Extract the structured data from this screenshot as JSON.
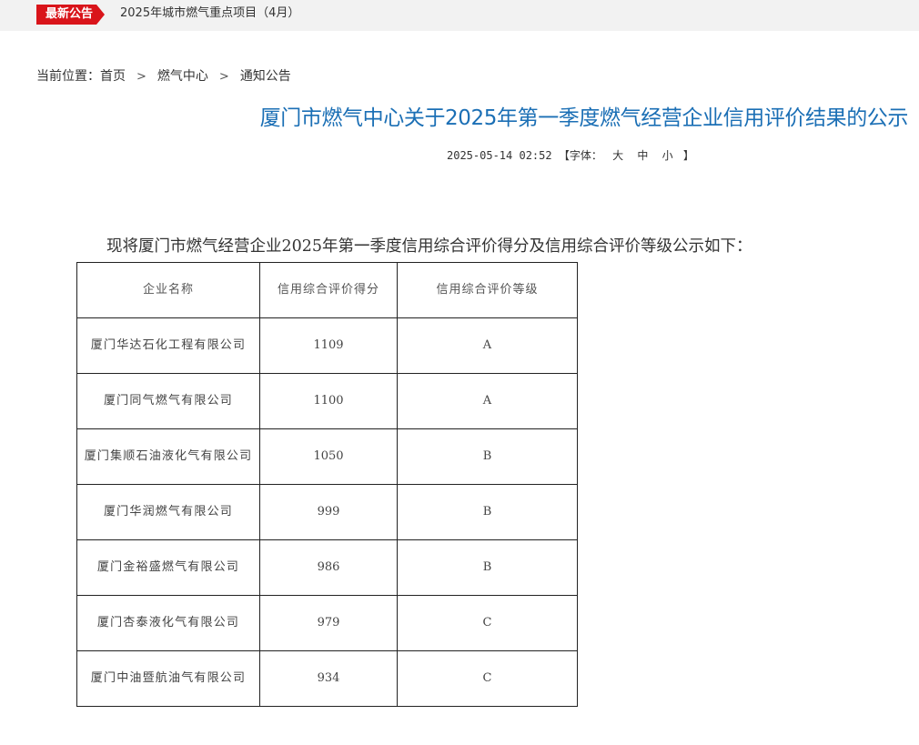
{
  "ticker": {
    "badge": "最新公告",
    "headline": "2025年城市燃气重点项目（4月）"
  },
  "breadcrumb": {
    "label": "当前位置：",
    "items": [
      "首页",
      "燃气中心",
      "通知公告"
    ]
  },
  "article": {
    "title": "厦门市燃气中心关于2025年第一季度燃气经营企业信用评价结果的公示",
    "datetime": "2025-05-14 02:52",
    "font_label_open": "【字体：",
    "font_sizes": [
      "大",
      "中",
      "小"
    ],
    "font_label_close": "】",
    "intro": "现将厦门市燃气经营企业2025年第一季度信用综合评价得分及信用综合评价等级公示如下："
  },
  "table": {
    "headers": [
      "企业名称",
      "信用综合评价得分",
      "信用综合评价等级"
    ],
    "rows": [
      {
        "name": "厦门华达石化工程有限公司",
        "score": "1109",
        "grade": "A"
      },
      {
        "name": "厦门同气燃气有限公司",
        "score": "1100",
        "grade": "A"
      },
      {
        "name": "厦门集顺石油液化气有限公司",
        "score": "1050",
        "grade": "B"
      },
      {
        "name": "厦门华润燃气有限公司",
        "score": "999",
        "grade": "B"
      },
      {
        "name": "厦门金裕盛燃气有限公司",
        "score": "986",
        "grade": "B"
      },
      {
        "name": "厦门杏泰液化气有限公司",
        "score": "979",
        "grade": "C"
      },
      {
        "name": "厦门中油暨航油气有限公司",
        "score": "934",
        "grade": "C"
      }
    ]
  },
  "colors": {
    "badge_red": "#d9141a",
    "title_blue": "#1b6fb5",
    "topbar_bg": "#f2f2f2"
  }
}
